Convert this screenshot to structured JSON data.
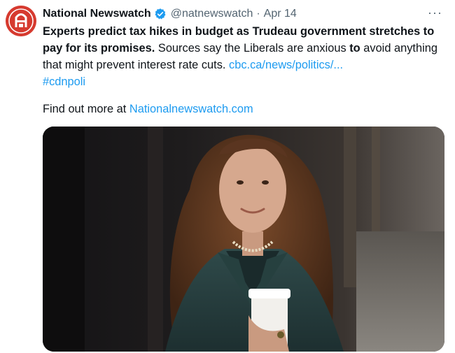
{
  "tweet": {
    "display_name": "National Newswatch",
    "handle": "@natnewswatch",
    "separator": "·",
    "date": "Apr 14",
    "more_label": "···",
    "headline": "Experts predict tax hikes in budget as Trudeau government stretches to pay for its promises.",
    "text_part1": " Sources say the Liberals are anxious ",
    "text_bold": "to",
    "text_part2": " avoid anything that might prevent interest rate cuts. ",
    "link": "cbc.ca/news/politics/...",
    "hashtag": "#cdnpoli",
    "findout_prefix": "Find out more at ",
    "findout_link": "Nationalnewswatch.com"
  },
  "icons": {
    "avatar": "national-newswatch-logo",
    "verified": "verified-badge-icon",
    "more": "more-options-icon"
  },
  "colors": {
    "brand_red": "#d63a2f",
    "verified_blue": "#1d9bf0",
    "link": "#1d9bf0",
    "secondary_text": "#536471"
  }
}
